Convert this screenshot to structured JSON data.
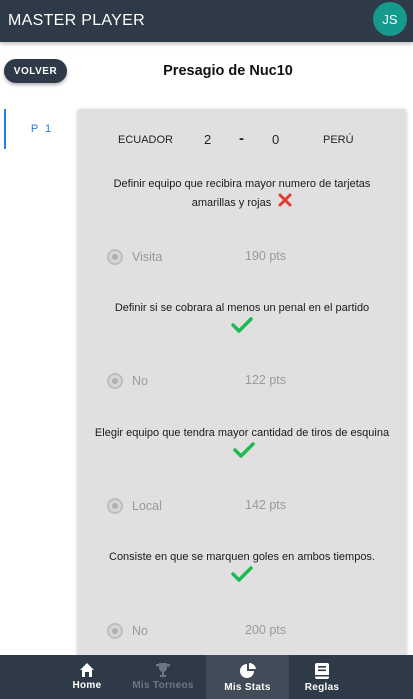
{
  "app": {
    "title": "MASTER PLAYER",
    "avatar_initials": "JS",
    "avatar_color": "#169a8e"
  },
  "header": {
    "back_label": "VOLVER",
    "title": "Presagio de Nuc10"
  },
  "tabs": [
    {
      "label": "P 1",
      "active": true
    }
  ],
  "match": {
    "home_team": "ECUADOR",
    "home_score": "2",
    "separator": "-",
    "away_score": "0",
    "away_team": "PERÚ"
  },
  "questions": [
    {
      "text": "Definir equipo que recibira mayor numero de tarjetas amarillas y rojas",
      "result": "incorrect",
      "result_icon": "cross-icon",
      "answer": "Visita",
      "points": "190 pts"
    },
    {
      "text": "Definir si se cobrara al menos un penal en el partido",
      "result": "correct",
      "result_icon": "check-icon",
      "answer": "No",
      "points": "122 pts"
    },
    {
      "text": "Elegir equipo que tendra mayor cantidad de tiros de esquina",
      "result": "correct",
      "result_icon": "check-icon",
      "answer": "Local",
      "points": "142 pts"
    },
    {
      "text": "Consiste en que se marquen goles en ambos tiempos.",
      "result": "correct",
      "result_icon": "check-icon",
      "answer": "No",
      "points": "200 pts"
    }
  ],
  "colors": {
    "primary": "#2e3a47",
    "accent": "#1f7ee0",
    "correct": "#1db954",
    "incorrect": "#e53935"
  },
  "bottom_nav": [
    {
      "label": "Home",
      "icon": "home-icon",
      "state": "normal"
    },
    {
      "label": "Mis Torneos",
      "icon": "trophy-icon",
      "state": "disabled"
    },
    {
      "label": "Mis Stats",
      "icon": "pie-chart-icon",
      "state": "active"
    },
    {
      "label": "Reglas",
      "icon": "book-icon",
      "state": "normal"
    }
  ]
}
